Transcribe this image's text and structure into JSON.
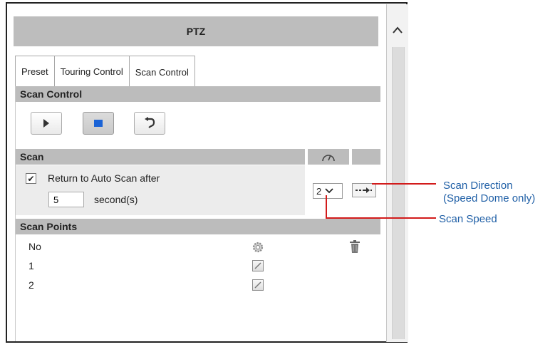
{
  "header": {
    "title": "PTZ"
  },
  "tabs": [
    {
      "label": "Preset",
      "active": false
    },
    {
      "label": "Touring Control",
      "active": false
    },
    {
      "label": "Scan Control",
      "active": true
    }
  ],
  "scan_control": {
    "title": "Scan Control",
    "buttons": {
      "play": "play-icon",
      "stop": "stop-icon",
      "return": "return-icon"
    }
  },
  "scan": {
    "title": "Scan",
    "return_checked": true,
    "return_label": "Return to Auto Scan after",
    "seconds_value": "5",
    "seconds_label": "second(s)",
    "speed_value": "2"
  },
  "scan_points": {
    "title": "Scan Points",
    "header_no": "No",
    "rows": [
      "1",
      "2"
    ]
  },
  "annotations": {
    "direction_line1": "Scan Direction",
    "direction_line2": "(Speed Dome only)",
    "speed": "Scan Speed"
  },
  "colors": {
    "annotation_text": "#1f5fa6",
    "annotation_line": "#d21b1b",
    "header_bg": "#bdbdbd"
  }
}
